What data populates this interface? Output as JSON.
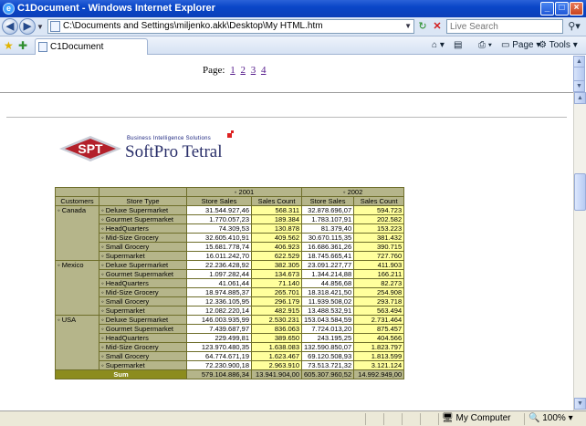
{
  "window": {
    "title": "C1Document - Windows Internet Explorer"
  },
  "address": {
    "url": "C:\\Documents and Settings\\miljenko.akk\\Desktop\\My HTML.htm"
  },
  "search": {
    "placeholder": "Live Search"
  },
  "tab": {
    "label": "C1Document"
  },
  "toolbar": {
    "page_label": "Page",
    "tools_label": "Tools"
  },
  "pager": {
    "label": "Page:",
    "pages": [
      "1",
      "2",
      "3",
      "4"
    ]
  },
  "logo": {
    "abbr": "SPT",
    "tagline": "Business  Intelligence  Solutions",
    "name": "SoftPro Tetral"
  },
  "table": {
    "headers": {
      "customers": "Customers",
      "store_type": "Store Type",
      "year1": "2001",
      "year2": "2002",
      "store_sales": "Store Sales",
      "sales_count": "Sales Count"
    },
    "groups": [
      {
        "name": "Canada",
        "rows": [
          [
            "Deluxe Supermarket",
            "31.544.927,46",
            "568.311",
            "32.878.696,07",
            "594.723"
          ],
          [
            "Gourmet Supermarket",
            "1.770.057,23",
            "189.384",
            "1.783.107,91",
            "202.582"
          ],
          [
            "HeadQuarters",
            "74.309,53",
            "130.878",
            "81.379,40",
            "153.223"
          ],
          [
            "Mid-Size Grocery",
            "32.605.410,91",
            "409.562",
            "30.670.115,35",
            "381.432"
          ],
          [
            "Small Grocery",
            "15.681.778,74",
            "406.923",
            "16.686.361,26",
            "390.715"
          ],
          [
            "Supermarket",
            "16.011.242,70",
            "622.529",
            "18.745.665,41",
            "727.760"
          ]
        ]
      },
      {
        "name": "Mexico",
        "rows": [
          [
            "Deluxe Supermarket",
            "22.236.428,92",
            "382.305",
            "23.091.227,77",
            "411.903"
          ],
          [
            "Gourmet Supermarket",
            "1.097.282,44",
            "134.673",
            "1.344.214,88",
            "166.211"
          ],
          [
            "HeadQuarters",
            "41.061,44",
            "71.140",
            "44.856,68",
            "82.273"
          ],
          [
            "Mid-Size Grocery",
            "18.974.885,37",
            "265.701",
            "18.318.421,50",
            "254.908"
          ],
          [
            "Small Grocery",
            "12.336.105,95",
            "296.179",
            "11.939.508,02",
            "293.718"
          ],
          [
            "Supermarket",
            "12.082.220,14",
            "482.915",
            "13.488.532,91",
            "563.494"
          ]
        ]
      },
      {
        "name": "USA",
        "rows": [
          [
            "Deluxe Supermarket",
            "146.003.935,99",
            "2.530.231",
            "153.043.584,59",
            "2.731.464"
          ],
          [
            "Gourmet Supermarket",
            "7.439.687,97",
            "836.063",
            "7.724.013,20",
            "875.457"
          ],
          [
            "HeadQuarters",
            "229.499,81",
            "389.650",
            "243.195,25",
            "404.566"
          ],
          [
            "Mid-Size Grocery",
            "123.970.480,35",
            "1.638.083",
            "132.590.850,07",
            "1.823.797"
          ],
          [
            "Small Grocery",
            "64.774.671,19",
            "1.623.467",
            "69.120.508,93",
            "1.813.599"
          ],
          [
            "Supermarket",
            "72.230.900,18",
            "2.963.910",
            "73.513.721,32",
            "3.121.124"
          ]
        ]
      }
    ],
    "sum": {
      "label": "Sum",
      "values": [
        "579.104.886,34",
        "13.941.904,00",
        "605.307.960,52",
        "14.992.949,00"
      ]
    }
  },
  "status": {
    "zone": "My Computer",
    "zoom": "100%"
  }
}
